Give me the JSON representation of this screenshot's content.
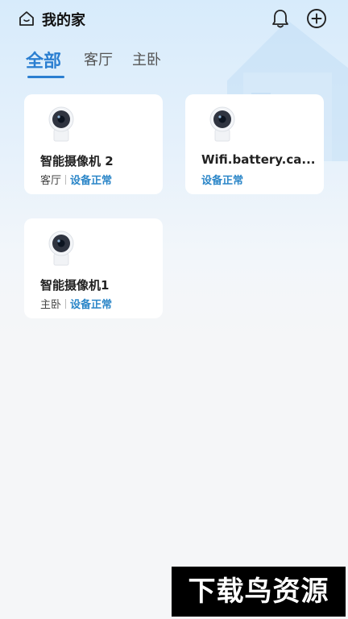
{
  "header": {
    "title": "我的家",
    "home_icon": "home-icon",
    "bell_icon": "bell-icon",
    "add_icon": "add-circle-icon"
  },
  "tabs": [
    {
      "label": "全部",
      "active": true
    },
    {
      "label": "客厅",
      "active": false
    },
    {
      "label": "主卧",
      "active": false
    }
  ],
  "devices": [
    {
      "name": "智能摄像机 2",
      "room": "客厅",
      "status": "设备正常",
      "icon": "camera-icon"
    },
    {
      "name": "Wifi.battery.ca...",
      "room": "",
      "status": "设备正常",
      "icon": "camera-icon"
    },
    {
      "name": "智能摄像机1",
      "room": "主卧",
      "status": "设备正常",
      "icon": "camera-icon"
    }
  ],
  "watermark": "下载鸟资源",
  "colors": {
    "accent": "#2b7fd1",
    "status": "#2b86c8",
    "background": "#f5f6f8"
  }
}
